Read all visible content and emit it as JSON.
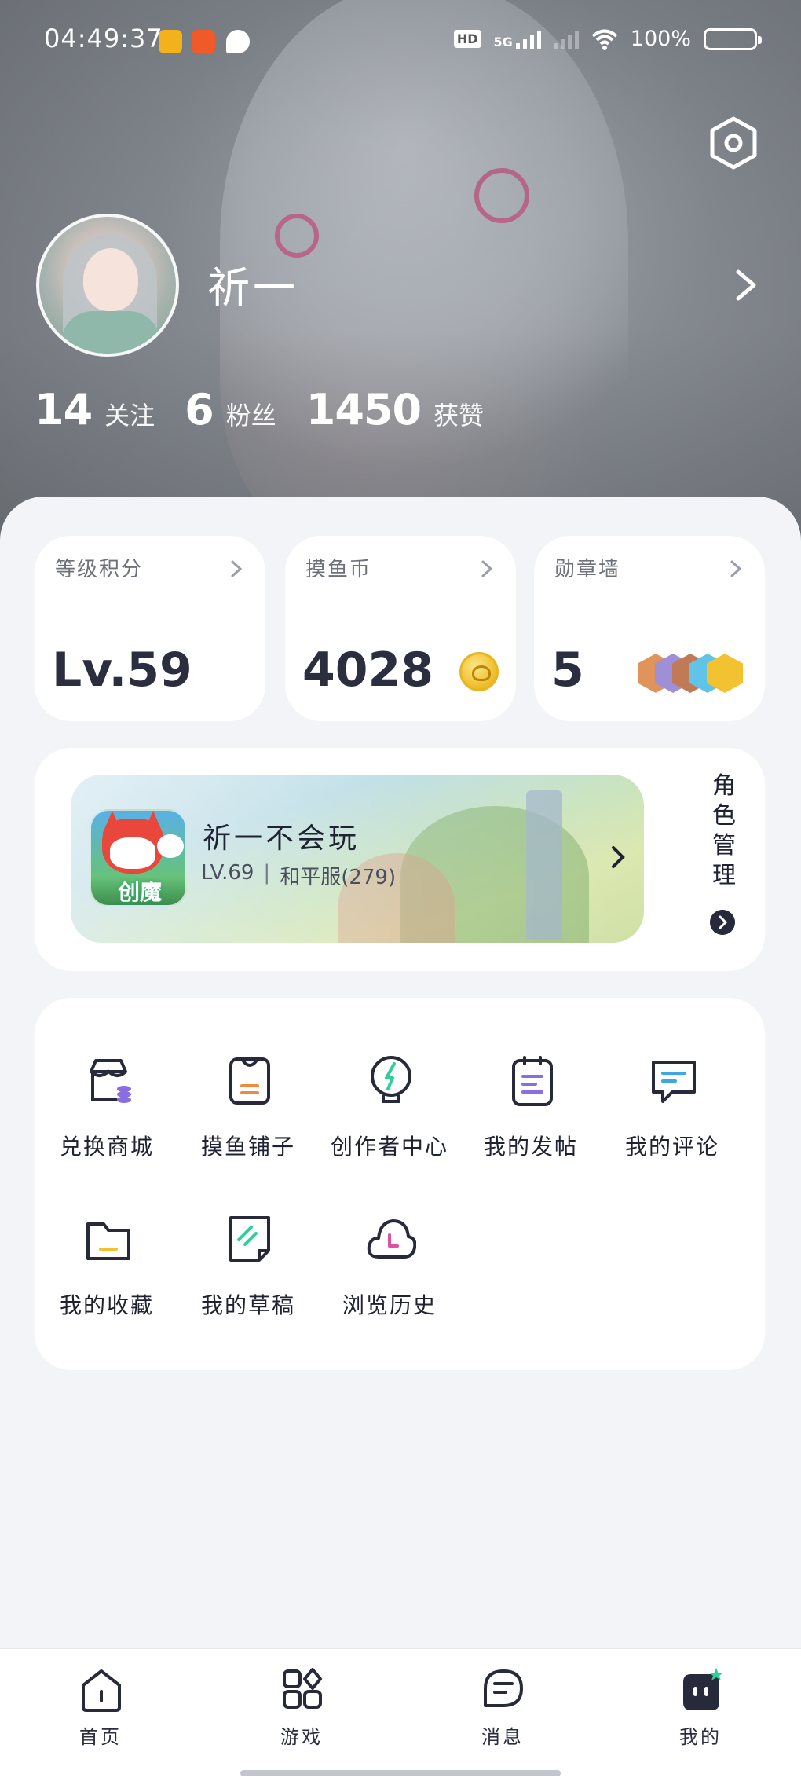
{
  "status_bar": {
    "time": "04:49:37",
    "network": "5G",
    "hd": "HD",
    "battery": "100%",
    "icons": [
      "app-a-icon",
      "app-orange-icon",
      "chat-bubble-icon",
      "hd-icon",
      "5g-signal-icon",
      "signal-icon",
      "wifi-icon",
      "battery-icon"
    ]
  },
  "profile": {
    "name": "祈一",
    "stats": [
      {
        "value": "14",
        "label": "关注"
      },
      {
        "value": "6",
        "label": "粉丝"
      },
      {
        "value": "1450",
        "label": "获赞"
      }
    ]
  },
  "summary_cards": [
    {
      "title": "等级积分",
      "value": "Lv.59"
    },
    {
      "title": "摸鱼币",
      "value": "4028"
    },
    {
      "title": "勋章墙",
      "value": "5"
    }
  ],
  "role_card": {
    "game_logo": "创魔",
    "name": "祈一不会玩",
    "level": "LV.69",
    "separator": "|",
    "server": "和平服(279)",
    "manage_label": [
      "角",
      "色",
      "管",
      "理"
    ]
  },
  "functions": [
    {
      "label": "兑换商城",
      "icon": "store-icon"
    },
    {
      "label": "摸鱼铺子",
      "icon": "shop-bag-icon"
    },
    {
      "label": "创作者中心",
      "icon": "lightbulb-icon"
    },
    {
      "label": "我的发帖",
      "icon": "clipboard-icon"
    },
    {
      "label": "我的评论",
      "icon": "comment-icon"
    },
    {
      "label": "我的收藏",
      "icon": "folder-icon"
    },
    {
      "label": "我的草稿",
      "icon": "draft-icon"
    },
    {
      "label": "浏览历史",
      "icon": "history-cloud-icon"
    }
  ],
  "bottom_nav": [
    {
      "label": "首页",
      "icon": "home-icon"
    },
    {
      "label": "游戏",
      "icon": "games-icon"
    },
    {
      "label": "消息",
      "icon": "message-icon"
    },
    {
      "label": "我的",
      "icon": "profile-face-icon",
      "active": true
    }
  ],
  "colors": {
    "accent_orange": "#f08a3c",
    "accent_blue": "#3da7e6",
    "accent_purple": "#8a6de0",
    "accent_green": "#2fcf9c",
    "accent_pink": "#e24ea8",
    "accent_yellow": "#f2c230",
    "dark": "#272a3a"
  }
}
